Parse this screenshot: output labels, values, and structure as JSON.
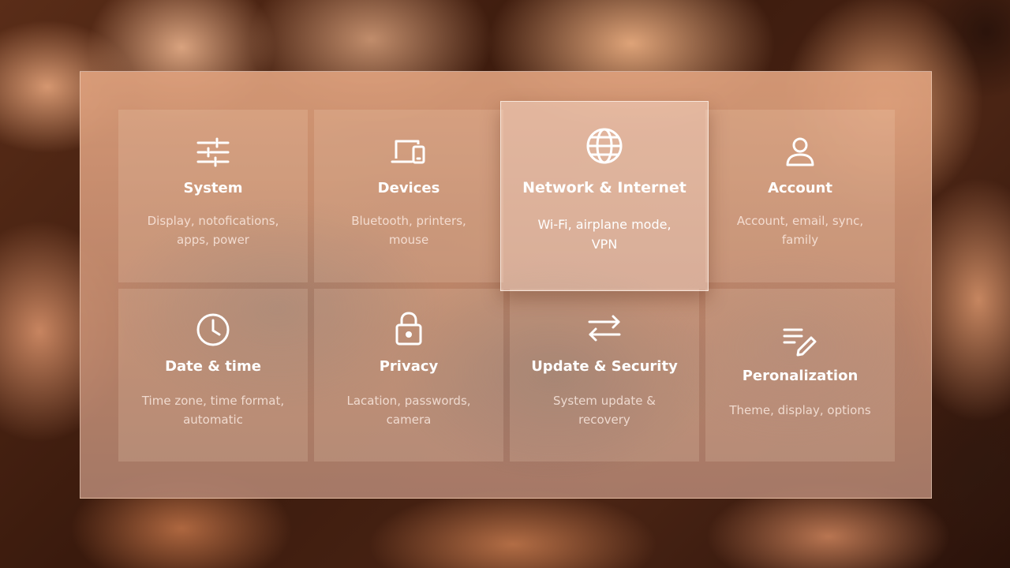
{
  "tiles": [
    {
      "title": "System",
      "description": "Display, notofications, apps, power",
      "icon": "sliders-icon"
    },
    {
      "title": "Devices",
      "description": "Bluetooth, printers, mouse",
      "icon": "devices-icon"
    },
    {
      "title": "Network & Internet",
      "description": "Wi-Fi, airplane mode, VPN",
      "icon": "globe-icon"
    },
    {
      "title": "Account",
      "description": "Account, email, sync, family",
      "icon": "person-icon"
    },
    {
      "title": "Date & time",
      "description": "Time zone, time format, automatic",
      "icon": "clock-icon"
    },
    {
      "title": "Privacy",
      "description": "Lacation, passwords, camera",
      "icon": "lock-icon"
    },
    {
      "title": "Update & Security",
      "description": "System update & recovery",
      "icon": "swap-arrows-icon"
    },
    {
      "title": "Peronalization",
      "description": "Theme, display, options",
      "icon": "edit-list-icon"
    }
  ],
  "active_tile": "Network & Internet"
}
